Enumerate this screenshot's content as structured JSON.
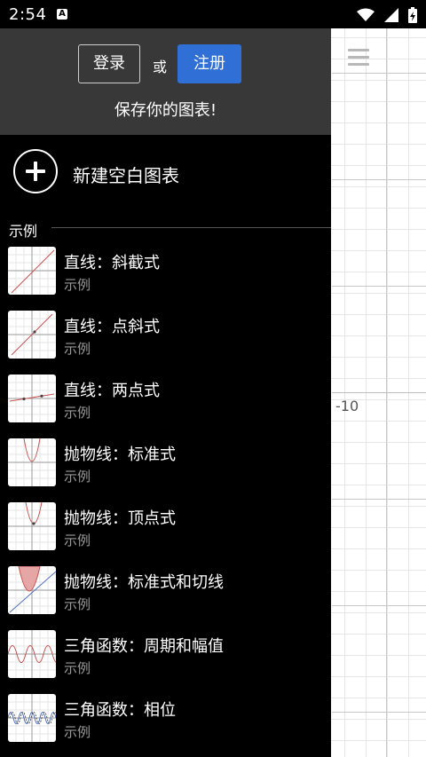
{
  "status_bar": {
    "time": "2:54",
    "notification_badge": "A",
    "icons": [
      "wifi-icon",
      "signal-icon",
      "battery-charging-icon"
    ]
  },
  "graph": {
    "axis_label": "-10",
    "menu_icon": "hamburger-menu-icon"
  },
  "drawer": {
    "login_label": "登录",
    "or_label": "或",
    "register_label": "注册",
    "save_prompt": "保存你的图表!",
    "new_graph_label": "新建空白图表",
    "section_title": "示例",
    "accent_color": "#2f6fd6",
    "items": [
      {
        "title": "直线：斜截式",
        "subtitle": "示例",
        "thumb": "line-thumbnail"
      },
      {
        "title": "直线：点斜式",
        "subtitle": "示例",
        "thumb": "line-point-thumbnail"
      },
      {
        "title": "直线：两点式",
        "subtitle": "示例",
        "thumb": "line-two-point-thumbnail"
      },
      {
        "title": "抛物线：标准式",
        "subtitle": "示例",
        "thumb": "parabola-thumbnail"
      },
      {
        "title": "抛物线：顶点式",
        "subtitle": "示例",
        "thumb": "parabola-vertex-thumbnail"
      },
      {
        "title": "抛物线：标准式和切线",
        "subtitle": "示例",
        "thumb": "parabola-tangent-thumbnail"
      },
      {
        "title": "三角函数：周期和幅值",
        "subtitle": "示例",
        "thumb": "sine-thumbnail"
      },
      {
        "title": "三角函数：相位",
        "subtitle": "示例",
        "thumb": "sine-phase-thumbnail"
      }
    ]
  }
}
